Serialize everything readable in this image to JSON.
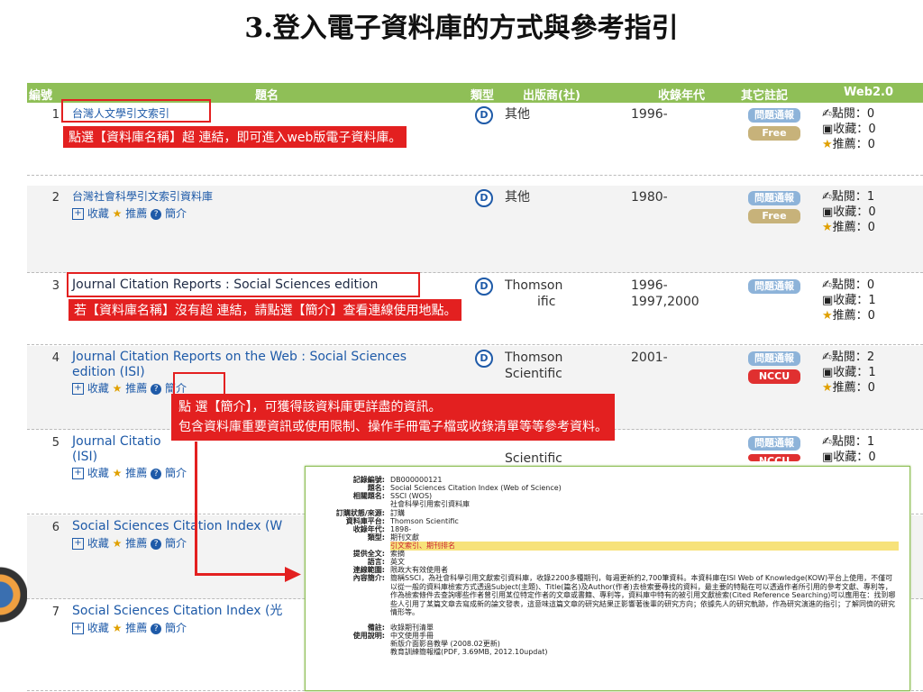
{
  "slide_title": "3.登入電子資料庫的方式與參考指引",
  "header": {
    "num": "編號",
    "title": "題名",
    "type": "類型",
    "publisher": "出版商(社)",
    "years": "收錄年代",
    "notes": "其它註記",
    "web": "Web2.0"
  },
  "labels": {
    "collect": "收藏",
    "recommend": "推薦",
    "intro": "簡介",
    "views": "點閱：",
    "saves": "收藏：",
    "recs": "推薦：",
    "type_icon": "D"
  },
  "rows": [
    {
      "num": "1",
      "title": "台灣人文學引文索引",
      "publisher": "其他",
      "years": "1996-",
      "badge1": "問題通報",
      "badge2": "Free",
      "views": "0",
      "saves": "0",
      "recs": "0"
    },
    {
      "num": "2",
      "title": "台灣社會科學引文索引資料庫",
      "publisher": "其他",
      "years": "1980-",
      "badge1": "問題通報",
      "badge2": "Free",
      "views": "1",
      "saves": "0",
      "recs": "0"
    },
    {
      "num": "3",
      "title": "Journal Citation Reports : Social Sciences edition",
      "publisher": "Thomson",
      "publisher2": "ific",
      "years": "1996-",
      "years2": "1997,2000",
      "badge1": "問題通報",
      "views": "0",
      "saves": "1",
      "recs": "0"
    },
    {
      "num": "4",
      "title": "Journal Citation Reports on the Web : Social Sciences",
      "title2": "edition (ISI)",
      "publisher": "Thomson",
      "publisher2": "Scientific",
      "years": "2001-",
      "badge1": "問題通報",
      "badge2": "NCCU",
      "views": "2",
      "saves": "1",
      "recs": "0"
    },
    {
      "num": "5",
      "title": "Journal Citatio",
      "title2": "(ISI)",
      "publisher2": "Scientific",
      "badge1": "問題通報",
      "badge2": "NCCU",
      "views": "1",
      "saves": "0"
    },
    {
      "num": "6",
      "title": "Social Sciences Citation Index (W"
    },
    {
      "num": "7",
      "title": "Social Sciences Citation Index (光"
    }
  ],
  "callouts": {
    "c1": "點選【資料庫名稱】超 連結，即可進入web版電子資料庫。",
    "c2": "若【資料庫名稱】沒有超 連結，請點選【簡介】查看連線使用地點。",
    "c3a": "點 選【簡介】，可獲得該資料庫更詳盡的資訊。",
    "c3b": "包含資料庫重要資訊或使用限制、操作手冊電子檔或收錄清單等等參考資料。"
  },
  "detail": [
    {
      "label": "記錄編號:",
      "value": "DB000000121"
    },
    {
      "label": "題名:",
      "value": "Social Sciences Citation Index (Web of Science)"
    },
    {
      "label": "相關題名:",
      "value": "SSCI (WOS)"
    },
    {
      "label": "",
      "value": "社會科學引用索引資料庫"
    },
    {
      "label": "訂購狀態/來源:",
      "value": "訂購"
    },
    {
      "label": "資料庫平台:",
      "value": "Thomson Scientific"
    },
    {
      "label": "收錄年代:",
      "value": "1898-"
    },
    {
      "label": "類型:",
      "value": "期刊文獻"
    },
    {
      "label": "",
      "value": "引文索引、期刊排名"
    },
    {
      "label": "提供全文:",
      "value": "索摘"
    },
    {
      "label": "語言:",
      "value": "英文"
    },
    {
      "label": "連線範圍:",
      "value": "限政大有效使用者"
    },
    {
      "label": "內容簡介:",
      "value": "簡稱SSCI，為社會科學引用文獻索引資料庫，收錄2200多種期刊，每週更新約2,700筆資料。本資料庫在ISI Web of Knowledge(KOW)平台上使用，不僅可以從一般的資料庫檢索方式透過Subject(主題)、Title(篇名)及Author(作者)去檢索要尋找的資料，最主要的特點在可以透過作者所引用的參考文獻、專利等，作為檢索條件去查詢哪些作者曾引用某位特定作者的文章或書籍、專利等，資料庫中特有的被引用文獻檢索(Cited Reference Searching)可以應用在：找到哪些人引用了某篇文章去寫成新的論文發表，這意味這篇文章的研究結果正影響著後輩的研究方向；依據先人的研究軌跡，作為研究演進的指引；了解同儕的研究情形等。"
    },
    {
      "label": "備註:",
      "value": "收錄期刊清單"
    },
    {
      "label": "使用說明:",
      "value": "中文使用手冊"
    },
    {
      "label": "",
      "value": "新版介面影音教學 (2008.02更新)"
    },
    {
      "label": "",
      "value": "教育訓練簡報檔(PDF, 3.69MB, 2012.10updat)"
    }
  ]
}
